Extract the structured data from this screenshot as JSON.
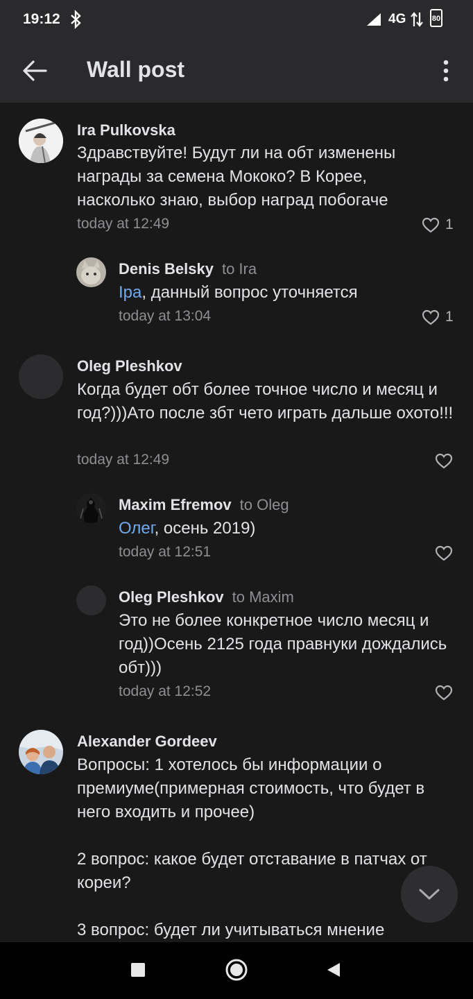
{
  "status": {
    "time": "19:12",
    "network": "4G",
    "battery": "80"
  },
  "header": {
    "title": "Wall post"
  },
  "comments": [
    {
      "author": "Ira Pulkovska",
      "reply_to": "",
      "mention": "",
      "text": "Здравствуйте! Будут ли на обт изменены награды за семена Мококо? В Корее, насколько знаю, выбор наград побогаче",
      "time": "today at 12:49",
      "likes": "1"
    },
    {
      "author": "Denis Belsky",
      "reply_to": "to Ira",
      "mention": "Іра",
      "text": ", данный вопрос уточняется",
      "time": "today at 13:04",
      "likes": "1"
    },
    {
      "author": "Oleg Pleshkov",
      "reply_to": "",
      "mention": "",
      "text": "Когда будет обт более точное число и месяц и год?)))Ато после збт чето играть дальше охото!!!",
      "time": "today at 12:49",
      "likes": ""
    },
    {
      "author": "Maxim Efremov",
      "reply_to": "to Oleg",
      "mention": "Олег",
      "text": ", осень 2019)",
      "time": "today at 12:51",
      "likes": ""
    },
    {
      "author": "Oleg Pleshkov",
      "reply_to": "to Maxim",
      "mention": "",
      "text": "Это не более конкретное число месяц и год))Осень 2125 года правнуки дождались обт)))",
      "time": "today at 12:52",
      "likes": ""
    },
    {
      "author": "Alexander Gordeev",
      "reply_to": "",
      "mention": "",
      "text_lines": [
        "Вопросы: 1 хотелось бы информации о премиуме(примерная стоимость, что будет в него входить и прочее)",
        "2 вопрос: какое будет отставание в патчах от кореи?",
        "3 вопрос: будет ли учитываться мнение"
      ],
      "time": "",
      "likes": ""
    }
  ],
  "colors": {
    "background": "#19191a",
    "bar": "#2a2a2c",
    "mention": "#71aaeb",
    "secondary": "#8d8f93"
  },
  "icons": {
    "back": "arrow-left-icon",
    "more": "more-vertical-icon",
    "like": "heart-outline-icon",
    "scroll": "chevron-down-icon"
  }
}
